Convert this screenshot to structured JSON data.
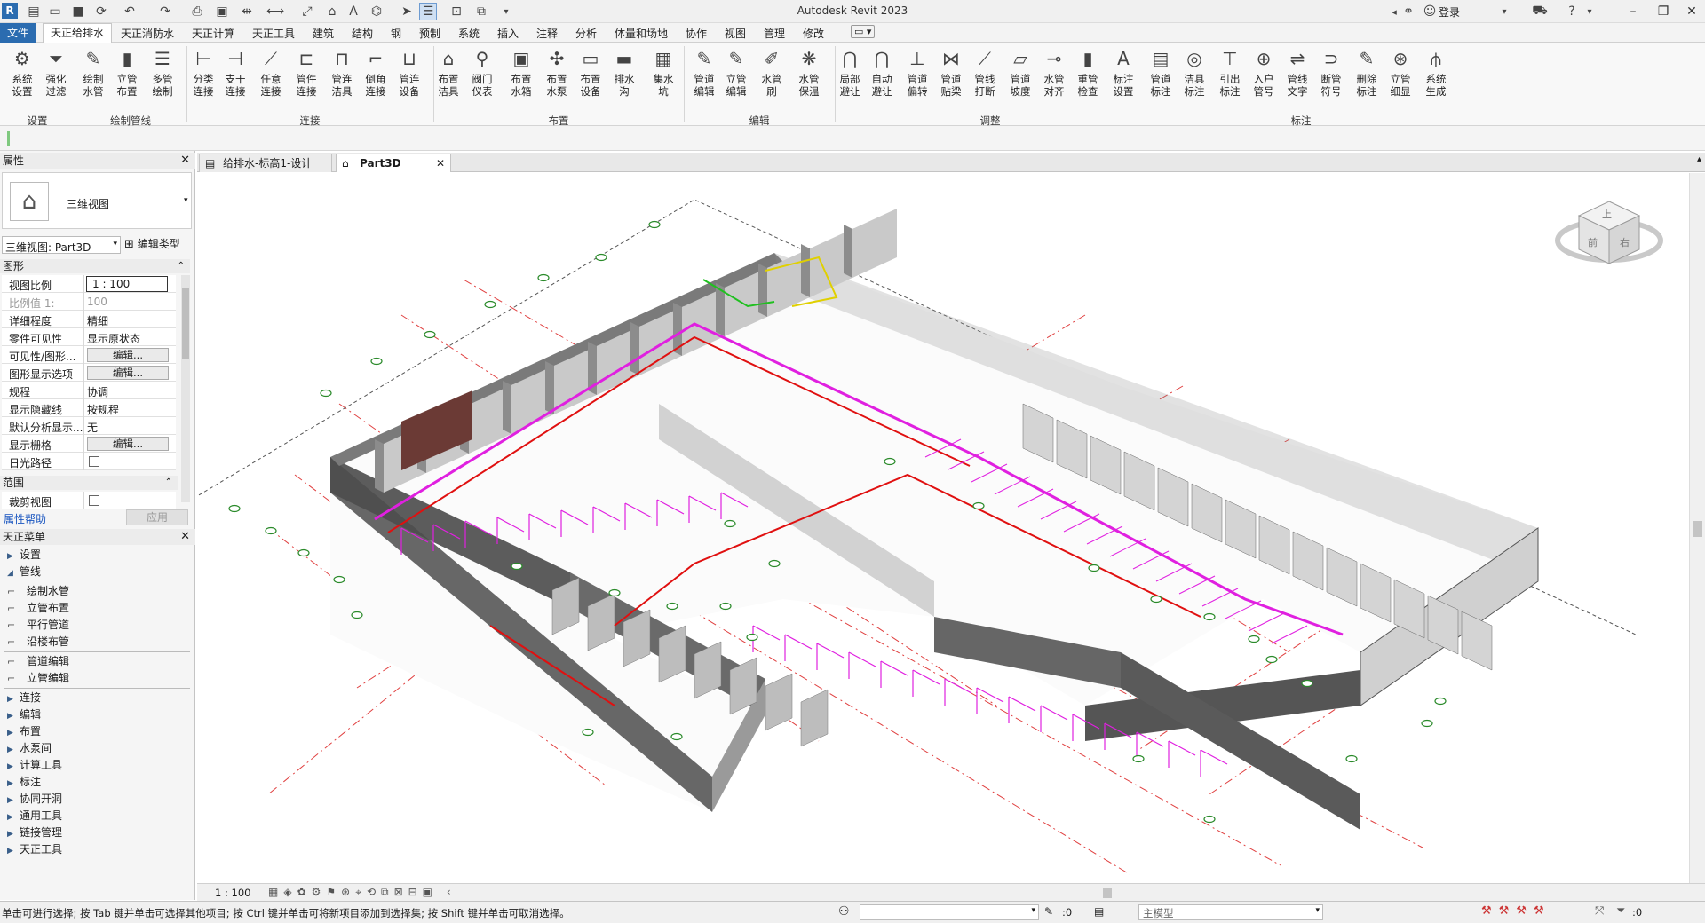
{
  "app": {
    "title": "Autodesk Revit 2023",
    "login": "登录"
  },
  "menu": [
    "文件",
    "天正给排水",
    "天正消防水",
    "天正计算",
    "天正工具",
    "建筑",
    "结构",
    "钢",
    "预制",
    "系统",
    "插入",
    "注释",
    "分析",
    "体量和场地",
    "协作",
    "视图",
    "管理",
    "修改"
  ],
  "ribbon": {
    "buttons": [
      {
        "l1": "系统",
        "l2": "设置"
      },
      {
        "l1": "强化",
        "l2": "过滤"
      },
      {
        "l1": "绘制",
        "l2": "水管"
      },
      {
        "l1": "立管",
        "l2": "布置"
      },
      {
        "l1": "多管",
        "l2": "绘制"
      },
      {
        "l1": "分类",
        "l2": "连接"
      },
      {
        "l1": "支干",
        "l2": "连接"
      },
      {
        "l1": "任意",
        "l2": "连接"
      },
      {
        "l1": "管件",
        "l2": "连接"
      },
      {
        "l1": "管连",
        "l2": "洁具"
      },
      {
        "l1": "倒角",
        "l2": "连接"
      },
      {
        "l1": "管连",
        "l2": "设备"
      },
      {
        "l1": "布置",
        "l2": "洁具"
      },
      {
        "l1": "阀门",
        "l2": "仪表"
      },
      {
        "l1": "布置",
        "l2": "水箱"
      },
      {
        "l1": "布置",
        "l2": "水泵"
      },
      {
        "l1": "布置",
        "l2": "设备"
      },
      {
        "l1": "排水沟",
        "l2": ""
      },
      {
        "l1": "集水坑",
        "l2": ""
      },
      {
        "l1": "管道",
        "l2": "编辑"
      },
      {
        "l1": "立管",
        "l2": "编辑"
      },
      {
        "l1": "水管刷",
        "l2": ""
      },
      {
        "l1": "水管",
        "l2": "保温"
      },
      {
        "l1": "局部",
        "l2": "避让"
      },
      {
        "l1": "自动",
        "l2": "避让"
      },
      {
        "l1": "管道",
        "l2": "偏转"
      },
      {
        "l1": "管道",
        "l2": "贴梁"
      },
      {
        "l1": "管线",
        "l2": "打断"
      },
      {
        "l1": "管道",
        "l2": "坡度"
      },
      {
        "l1": "水管",
        "l2": "对齐"
      },
      {
        "l1": "重管",
        "l2": "检查"
      },
      {
        "l1": "标注",
        "l2": "设置"
      },
      {
        "l1": "管道",
        "l2": "标注"
      },
      {
        "l1": "洁具",
        "l2": "标注"
      },
      {
        "l1": "引出",
        "l2": "标注"
      },
      {
        "l1": "入户",
        "l2": "管号"
      },
      {
        "l1": "管线",
        "l2": "文字"
      },
      {
        "l1": "断管",
        "l2": "符号"
      },
      {
        "l1": "删除",
        "l2": "标注"
      },
      {
        "l1": "立管",
        "l2": "细显"
      },
      {
        "l1": "系统",
        "l2": "生成"
      }
    ],
    "groups": [
      "设置",
      "绘制管线",
      "连接",
      "布置",
      "编辑",
      "调整",
      "标注"
    ]
  },
  "properties": {
    "header": "属性",
    "type_name": "三维视图",
    "view_selector": "三维视图: Part3D",
    "edit_type": "编辑类型",
    "section_graphics": "图形",
    "rows": [
      {
        "k": "视图比例",
        "v": "1 : 100"
      },
      {
        "k": "比例值 1:",
        "v": "100"
      },
      {
        "k": "详细程度",
        "v": "精细"
      },
      {
        "k": "零件可见性",
        "v": "显示原状态"
      },
      {
        "k": "可见性/图形...",
        "v": "编辑..."
      },
      {
        "k": "图形显示选项",
        "v": "编辑..."
      },
      {
        "k": "规程",
        "v": "协调"
      },
      {
        "k": "显示隐藏线",
        "v": "按规程"
      },
      {
        "k": "默认分析显示...",
        "v": "无"
      },
      {
        "k": "显示栅格",
        "v": "编辑..."
      },
      {
        "k": "日光路径",
        "v": ""
      }
    ],
    "section_extents": "范围",
    "crop_row": "裁剪视图",
    "help_link": "属性帮助",
    "apply": "应用"
  },
  "tz_menu": {
    "header": "天正菜单",
    "items": [
      {
        "label": "设置",
        "kind": "folder"
      },
      {
        "label": "管线",
        "kind": "open"
      },
      {
        "label": "绘制水管",
        "kind": "cmd"
      },
      {
        "label": "立管布置",
        "kind": "cmd"
      },
      {
        "label": "平行管道",
        "kind": "cmd"
      },
      {
        "label": "沿楼布管",
        "kind": "cmd"
      },
      {
        "label": "管道编辑",
        "kind": "cmd"
      },
      {
        "label": "立管编辑",
        "kind": "cmd"
      },
      {
        "label": "连接",
        "kind": "folder"
      },
      {
        "label": "编辑",
        "kind": "folder"
      },
      {
        "label": "布置",
        "kind": "folder"
      },
      {
        "label": "水泵间",
        "kind": "folder"
      },
      {
        "label": "计算工具",
        "kind": "folder"
      },
      {
        "label": "标注",
        "kind": "folder"
      },
      {
        "label": "协同开洞",
        "kind": "folder"
      },
      {
        "label": "通用工具",
        "kind": "folder"
      },
      {
        "label": "链接管理",
        "kind": "folder"
      },
      {
        "label": "天正工具",
        "kind": "folder"
      }
    ]
  },
  "tabs": [
    {
      "label": "给排水-标高1-设计",
      "active": false
    },
    {
      "label": "Part3D",
      "active": true
    }
  ],
  "viewcube": {
    "top": "上",
    "front": "前",
    "right": "右"
  },
  "viewbar": {
    "scale": "1 : 100"
  },
  "status": {
    "text": "单击可进行选择; 按 Tab 键并单击可选择其他项目; 按 Ctrl 键并单击可将新项目添加到选择集; 按 Shift 键并单击可取消选择。",
    "count1": ":0",
    "model": "主模型",
    "filter": ":0"
  },
  "colors": {
    "accent": "#2b6cb0",
    "pipe_magenta": "#e020e0",
    "pipe_red": "#e01010",
    "wall": "#5c5c5c"
  }
}
